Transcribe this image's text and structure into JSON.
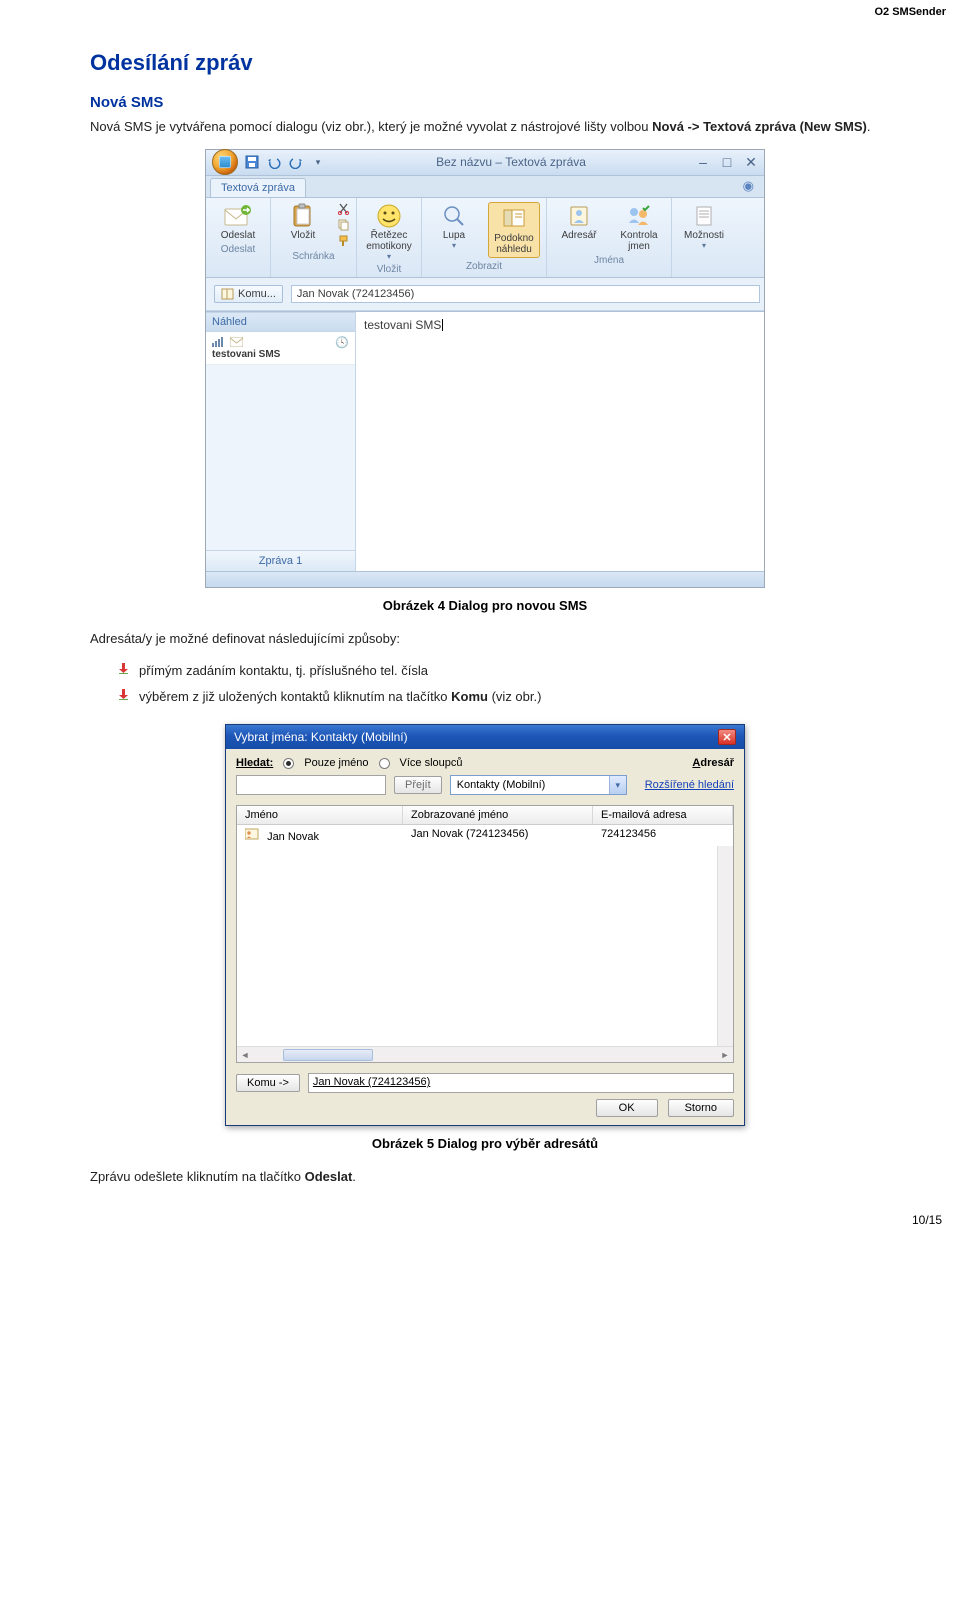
{
  "doc_header": "O2 SMSender",
  "page_number": "10/15",
  "section_title": "Odesílání zpráv",
  "subsection_title": "Nová SMS",
  "intro": {
    "pre": "Nová SMS je vytvářena pomocí dialogu (viz obr.), který je možné vyvolat z nástrojové lišty volbou ",
    "bold": "Nová -> Textová zpráva (New SMS)",
    "post": "."
  },
  "fig4": {
    "caption": "Obrázek 4 Dialog pro novou SMS",
    "window_title": "Bez názvu – Textová zpráva",
    "tab": "Textová zpráva",
    "groups": {
      "odeslat": {
        "btn": "Odeslat",
        "label": "Odeslat"
      },
      "schranka": {
        "btn": "Vložit",
        "label": "Schránka"
      },
      "vlozit": {
        "btn": "Řetězec emotikony",
        "label": "Vložit"
      },
      "zobrazit": {
        "lupa": "Lupa",
        "podokno": "Podokno náhledu",
        "label": "Zobrazit"
      },
      "jmena": {
        "adresar": "Adresář",
        "kontrola": "Kontrola jmen",
        "label": "Jména"
      },
      "moznosti": {
        "btn": "Možnosti"
      }
    },
    "komu_btn": "Komu...",
    "recipient": "Jan Novak (724123456)",
    "preview_header": "Náhled",
    "msg_item": "testovani SMS",
    "msg_body": "testovani SMS",
    "zprava_tab": "Zpráva 1"
  },
  "after_fig4": "Adresáta/y je možné definovat následujícími způsoby:",
  "bullets": {
    "b1": "přímým zadáním kontaktu, tj. příslušného tel. čísla",
    "b2_pre": "výběrem z již uložených kontaktů kliknutím na tlačítko ",
    "b2_bold": "Komu",
    "b2_post": " (viz obr.)"
  },
  "fig5": {
    "caption": "Obrázek 5 Dialog pro výběr adresátů",
    "title": "Vybrat jména: Kontakty (Mobilní)",
    "search_label": "Hledat:",
    "only_name": "Pouze jméno",
    "more_cols": "Více sloupců",
    "abook_label": "Adresář",
    "go_btn": "Přejít",
    "abook_value": "Kontakty (Mobilní)",
    "adv_search": "Rozšířené hledání",
    "cols": {
      "c1": "Jméno",
      "c2": "Zobrazované jméno",
      "c3": "E-mailová adresa"
    },
    "row": {
      "name": "Jan Novak",
      "display": "Jan Novak (724123456)",
      "email": "724123456"
    },
    "komu_btn": "Komu ->",
    "komu_value": "Jan Novak (724123456)",
    "ok": "OK",
    "cancel": "Storno"
  },
  "final": {
    "pre": "Zprávu odešlete kliknutím na tlačítko ",
    "bold": "Odeslat",
    "post": "."
  }
}
